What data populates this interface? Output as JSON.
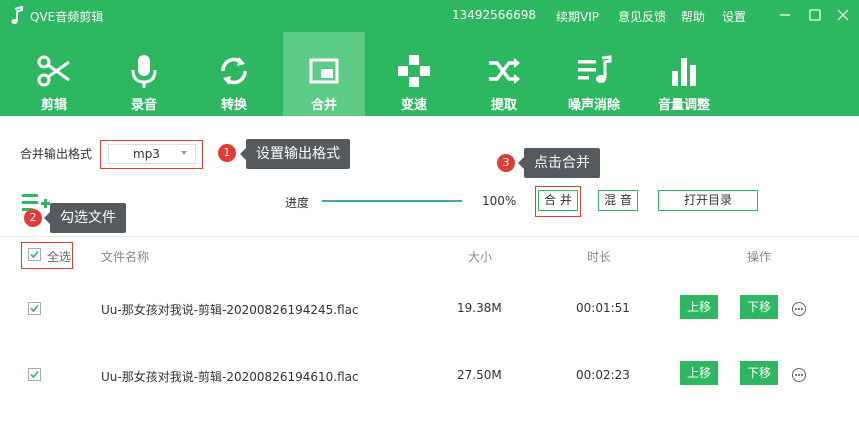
{
  "app": {
    "title": "QVE音频剪辑",
    "logo_icon": "music-note-icon"
  },
  "header": {
    "phone": "13492566698",
    "links": [
      "续期VIP",
      "意见反馈",
      "帮助",
      "设置"
    ]
  },
  "toolbar": {
    "items": [
      {
        "label": "剪辑",
        "icon": "scissors-icon"
      },
      {
        "label": "录音",
        "icon": "microphone-icon"
      },
      {
        "label": "转换",
        "icon": "convert-icon"
      },
      {
        "label": "合并",
        "icon": "merge-icon",
        "active": true
      },
      {
        "label": "变速",
        "icon": "speed-icon"
      },
      {
        "label": "提取",
        "icon": "extract-icon"
      },
      {
        "label": "噪声消除",
        "icon": "noise-removal-icon"
      },
      {
        "label": "音量调整",
        "icon": "volume-bars-icon"
      }
    ]
  },
  "settings": {
    "format_label": "合并输出格式",
    "format_value": "mp3",
    "progress_label": "进度",
    "progress_percent": "100%",
    "progress_value": 100,
    "merge_button": "合 并",
    "mix_button": "混 音",
    "open_dir_button": "打开目录"
  },
  "annotations": [
    {
      "number": "1",
      "text": "设置输出格式"
    },
    {
      "number": "2",
      "text": "勾选文件"
    },
    {
      "number": "3",
      "text": "点击合并"
    }
  ],
  "table": {
    "select_all": "全选",
    "columns": [
      "文件名称",
      "大小",
      "时长",
      "操作"
    ],
    "rows": [
      {
        "name": "Uu-那女孩对我说-剪辑-20200826194245.flac",
        "size": "19.38M",
        "duration": "00:01:51",
        "up": "上移",
        "down": "下移"
      },
      {
        "name": "Uu-那女孩对我说-剪辑-20200826194610.flac",
        "size": "27.50M",
        "duration": "00:02:23",
        "up": "上移",
        "down": "下移"
      }
    ]
  },
  "colors": {
    "brand": "#2eb761",
    "active_tab": "#5ccb86",
    "annotation": "#e53935",
    "tooltip": "#555a5e",
    "progress": "#3aa8b8"
  }
}
